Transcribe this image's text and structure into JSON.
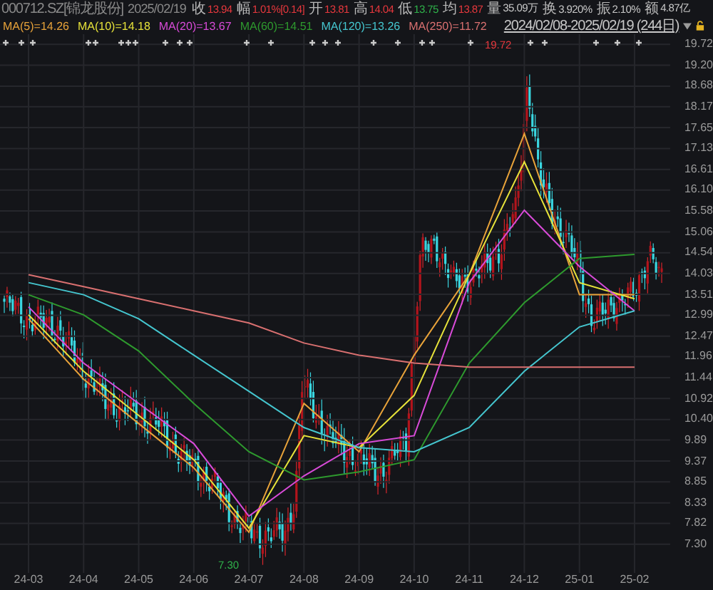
{
  "quote": {
    "code": "000712.SZ[锦龙股份]",
    "date": "2025/02/19",
    "fields": [
      {
        "label": "收",
        "value": "13.94",
        "color": "#e8383d"
      },
      {
        "label": "幅",
        "value": "1.01%[0.14]",
        "color": "#e8383d"
      },
      {
        "label": "开",
        "value": "13.81",
        "color": "#e8383d"
      },
      {
        "label": "高",
        "value": "14.04",
        "color": "#e8383d"
      },
      {
        "label": "低",
        "value": "13.75",
        "color": "#2fb24a"
      },
      {
        "label": "均",
        "value": "13.87",
        "color": "#e8383d"
      },
      {
        "label": "量",
        "value": "35.09万",
        "color": "#c8c8c8"
      },
      {
        "label": "换",
        "value": "3.920%",
        "color": "#c8c8c8"
      },
      {
        "label": "振",
        "value": "2.10%",
        "color": "#c8c8c8"
      },
      {
        "label": "额",
        "value": "4.87亿",
        "color": "#c8c8c8"
      }
    ]
  },
  "range": {
    "text": "2024/02/08-2025/02/19 (244日)"
  },
  "chart": {
    "high_marker": "19.72",
    "low_marker": "7.30",
    "chart_data": {
      "type": "line",
      "categories": [
        "24-03",
        "24-04",
        "24-05",
        "24-06",
        "24-07",
        "24-08",
        "24-09",
        "24-10",
        "24-11",
        "24-12",
        "25-01",
        "25-02"
      ],
      "ylim": [
        6.59,
        19.97
      ],
      "grid": true,
      "yticks": [
        {
          "value": 19.72,
          "label": "19.72"
        },
        {
          "value": 19.2,
          "label": "19.20"
        },
        {
          "value": 18.68,
          "label": "18.68"
        },
        {
          "value": 18.17,
          "label": "18.17"
        },
        {
          "value": 17.65,
          "label": "17.65"
        },
        {
          "value": 17.13,
          "label": "17.13"
        },
        {
          "value": 16.61,
          "label": "16.61"
        },
        {
          "value": 16.1,
          "label": "16.10"
        },
        {
          "value": 15.58,
          "label": "15.58"
        },
        {
          "value": 15.06,
          "label": "15.06"
        },
        {
          "value": 14.54,
          "label": "14.54"
        },
        {
          "value": 14.03,
          "label": "14.03"
        },
        {
          "value": 13.51,
          "label": "13.51"
        },
        {
          "value": 12.99,
          "label": "12.99"
        },
        {
          "value": 12.47,
          "label": "12.47"
        },
        {
          "value": 11.96,
          "label": "11.96"
        },
        {
          "value": 11.44,
          "label": "11.44"
        },
        {
          "value": 10.92,
          "label": "10.92"
        },
        {
          "value": 10.4,
          "label": "10.40"
        },
        {
          "value": 9.89,
          "label": "9.89"
        },
        {
          "value": 9.37,
          "label": "9.37"
        },
        {
          "value": 8.85,
          "label": "8.85"
        },
        {
          "value": 8.33,
          "label": "8.33"
        },
        {
          "value": 7.82,
          "label": "7.82"
        },
        {
          "value": 7.3,
          "label": "7.30"
        }
      ],
      "series": [
        {
          "name": "MA(5)=14.26",
          "color": "#e8a33a",
          "values": [
            12.9,
            11.4,
            10.3,
            9.2,
            7.6,
            10.8,
            9.6,
            12.0,
            14.0,
            17.5,
            13.5,
            13.5
          ]
        },
        {
          "name": "MA(10)=14.18",
          "color": "#e6e23a",
          "values": [
            13.0,
            11.6,
            10.5,
            9.4,
            7.7,
            10.0,
            9.7,
            11.0,
            14.0,
            16.8,
            13.8,
            13.4
          ]
        },
        {
          "name": "MA(20)=13.67",
          "color": "#d94bd9",
          "values": [
            13.2,
            11.8,
            10.8,
            9.8,
            8.0,
            9.0,
            9.8,
            10.0,
            13.8,
            15.6,
            14.2,
            13.1
          ]
        },
        {
          "name": "MA(60)=14.51",
          "color": "#2e9a2e",
          "values": [
            13.5,
            13.0,
            12.1,
            10.8,
            9.6,
            8.9,
            9.1,
            9.4,
            11.8,
            13.3,
            14.4,
            14.5
          ]
        },
        {
          "name": "MA(120)=13.26",
          "color": "#45c6cf",
          "values": [
            13.8,
            13.5,
            12.9,
            12.0,
            11.1,
            10.2,
            9.7,
            9.6,
            10.2,
            11.6,
            12.7,
            13.1
          ]
        },
        {
          "name": "MA(250)=11.72",
          "color": "#d97070",
          "values": [
            14.0,
            13.7,
            13.4,
            13.1,
            12.8,
            12.3,
            12.0,
            11.8,
            11.7,
            11.7,
            11.7,
            11.7
          ]
        }
      ]
    }
  }
}
